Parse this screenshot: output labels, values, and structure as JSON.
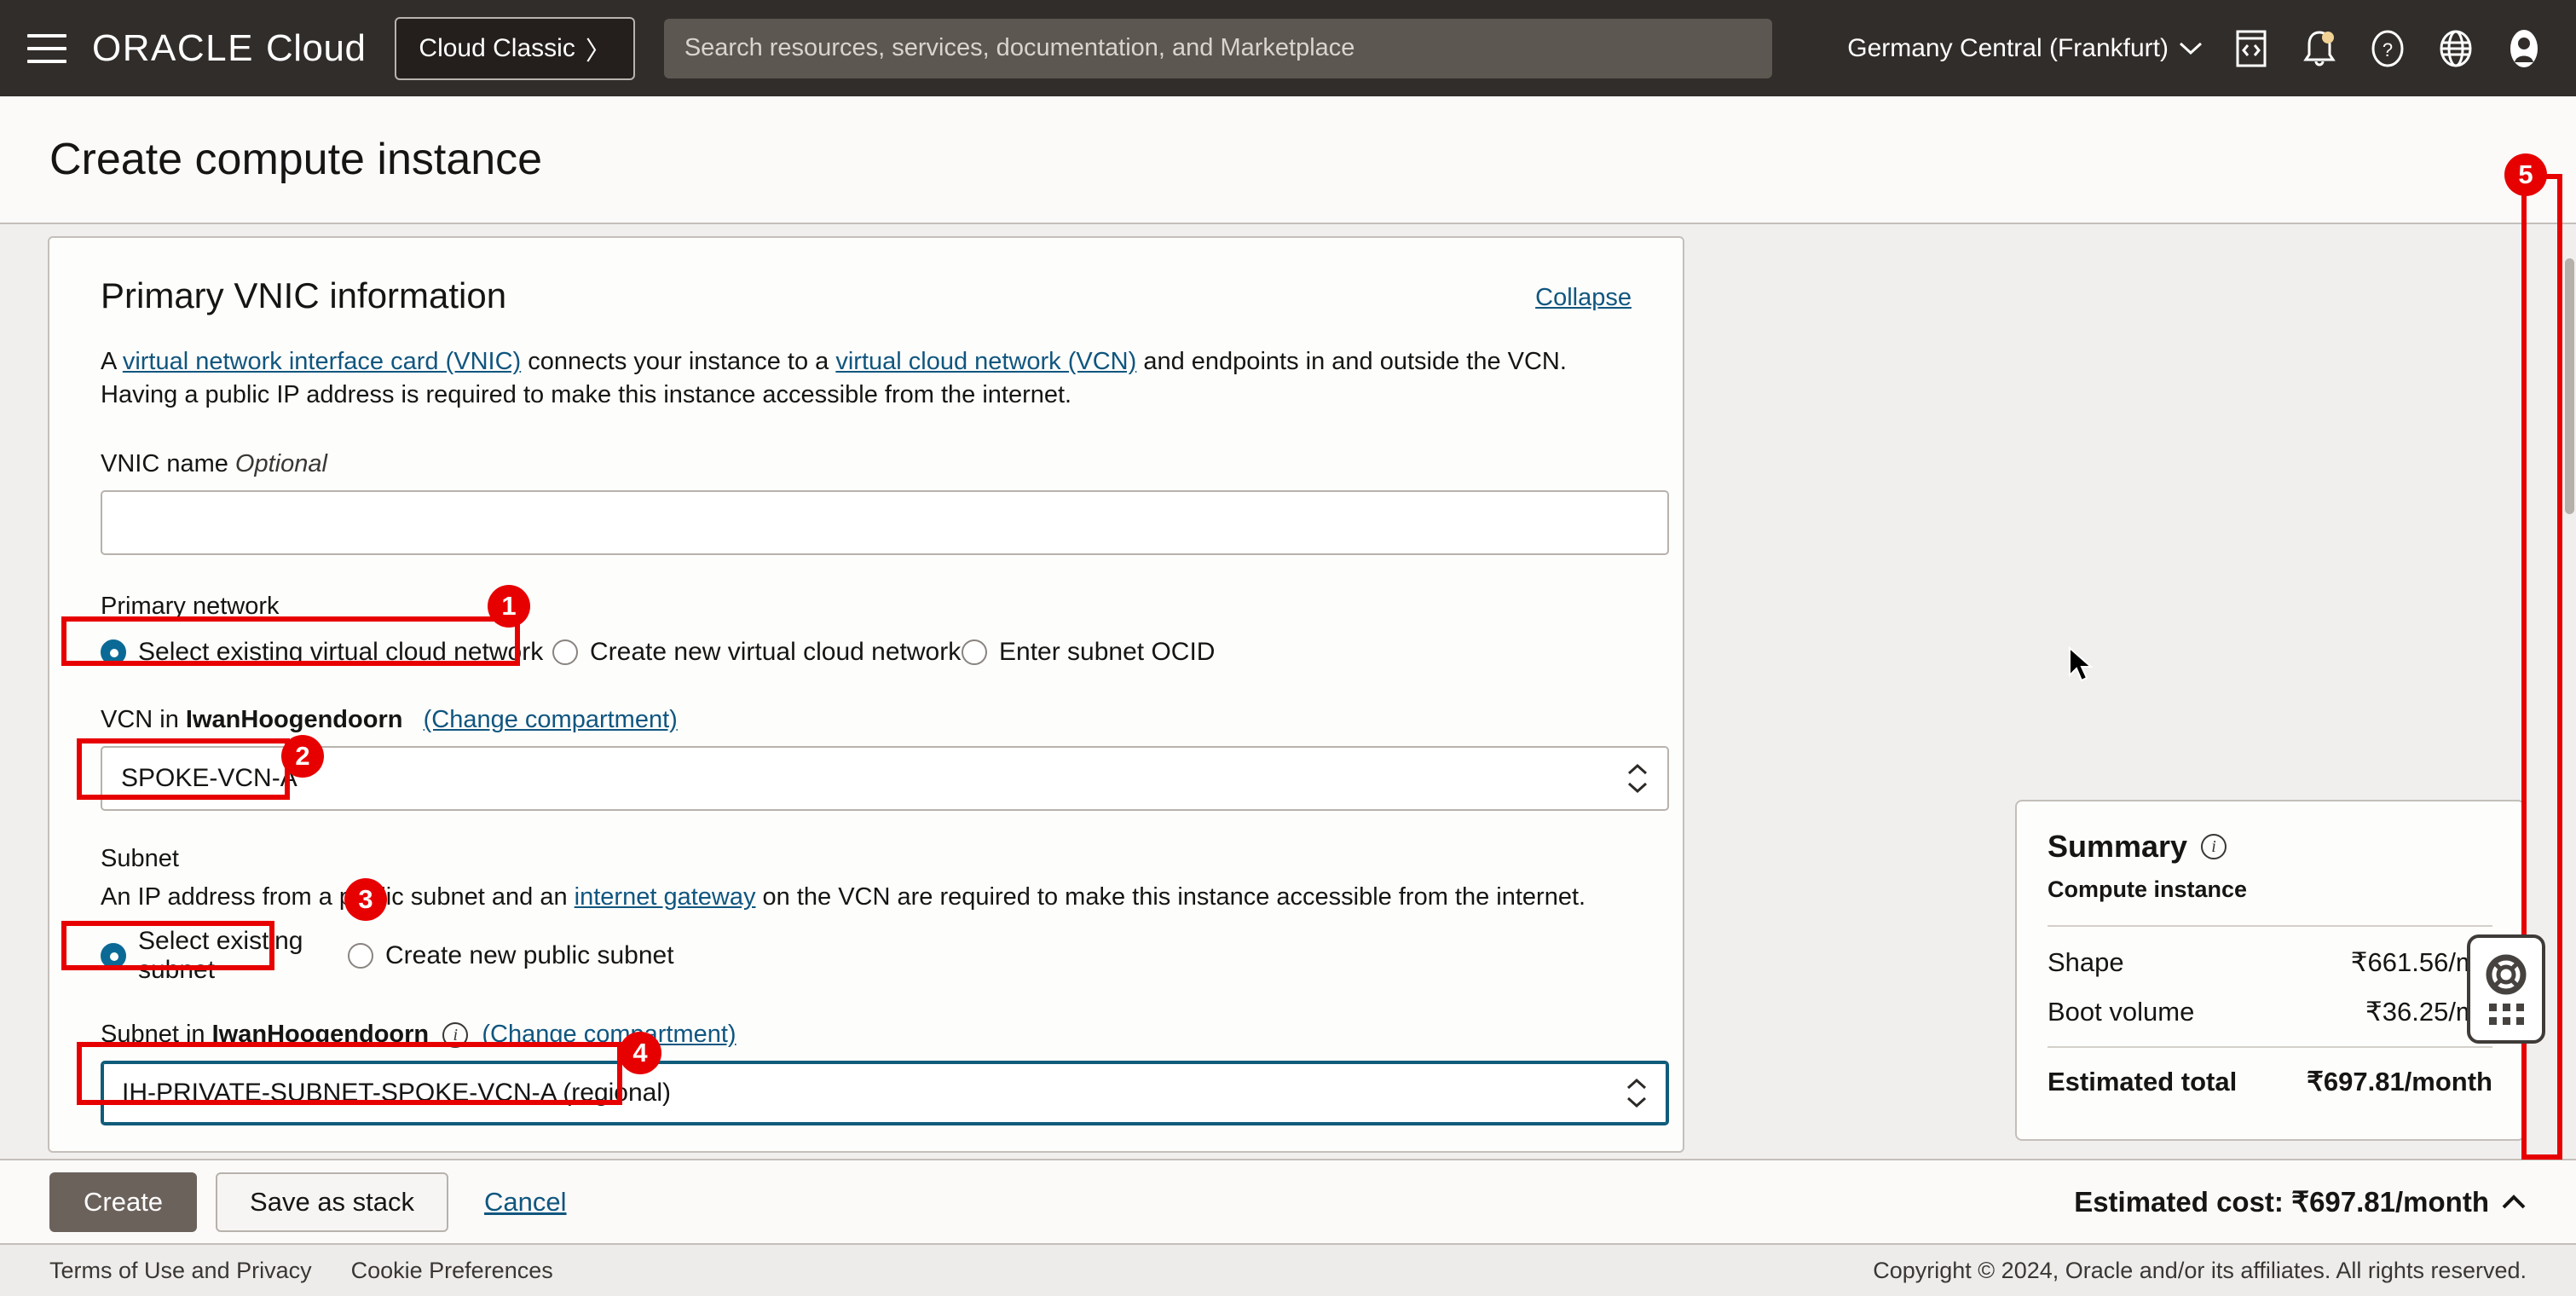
{
  "topnav": {
    "menu_icon": "hamburger-icon",
    "brand_oracle": "ORACLE",
    "brand_cloud": "Cloud",
    "cloud_classic_label": "Cloud Classic",
    "cloud_classic_chevron": "〉",
    "search_placeholder": "Search resources, services, documentation, and Marketplace",
    "region": "Germany Central (Frankfurt)",
    "region_chevron": "∨",
    "icons": [
      "cloud-shell-icon",
      "notifications-bell-icon",
      "help-question-icon",
      "globe-language-icon",
      "user-avatar-icon"
    ],
    "bg_color": "#312d2a"
  },
  "page": {
    "title": "Create compute instance"
  },
  "vnic_card": {
    "title": "Primary VNIC information",
    "collapse_label": "Collapse",
    "desc_part1": "A ",
    "desc_link1": "virtual network interface card (VNIC)",
    "desc_part2": " connects your instance to a ",
    "desc_link2": "virtual cloud network (VCN)",
    "desc_part3": " and endpoints in and outside the VCN. Having a public IP address is required to make this instance accessible from the internet.",
    "vnic_name_label": "VNIC name",
    "vnic_name_optional": "Optional",
    "vnic_name_value": "",
    "primary_network_label": "Primary network",
    "primary_network_options": [
      {
        "label": "Select existing virtual cloud network",
        "selected": true
      },
      {
        "label": "Create new virtual cloud network",
        "selected": false
      },
      {
        "label": "Enter subnet OCID",
        "selected": false
      }
    ],
    "vcn_label_prefix": "VCN in ",
    "vcn_compartment": "IwanHoogendoorn",
    "vcn_change_link": "(Change compartment)",
    "vcn_value": "SPOKE-VCN-A",
    "subnet_section_label": "Subnet",
    "subnet_help_part1": "An IP address from a public subnet and an ",
    "subnet_help_link": "internet gateway",
    "subnet_help_part2": " on the VCN are required to make this instance accessible from the internet.",
    "subnet_options": [
      {
        "label": "Select existing subnet",
        "selected": true
      },
      {
        "label": "Create new public subnet",
        "selected": false
      }
    ],
    "subnet_label_prefix": "Subnet in ",
    "subnet_compartment": "IwanHoogendoorn",
    "subnet_change_link": "(Change compartment)",
    "subnet_value": "IH-PRIVATE-SUBNET-SPOKE-VCN-A (regional)"
  },
  "summary": {
    "title": "Summary",
    "subtitle": "Compute instance",
    "rows": [
      {
        "label": "Shape",
        "value": "₹661.56/mo"
      },
      {
        "label": "Boot volume",
        "value": "₹36.25/mo"
      }
    ],
    "total_label": "Estimated total",
    "total_value": "₹697.81/month"
  },
  "help_widget": {
    "icon": "life-ring-icon",
    "grid_icon": "dots-grid-icon"
  },
  "action_bar": {
    "create_label": "Create",
    "save_stack_label": "Save as stack",
    "cancel_label": "Cancel",
    "estimated_cost": "Estimated cost: ₹697.81/month",
    "estimated_chevron": "∧"
  },
  "footer": {
    "terms": "Terms of Use and Privacy",
    "cookies": "Cookie Preferences",
    "copyright": "Copyright © 2024, Oracle and/or its affiliates. All rights reserved."
  },
  "annotations": [
    {
      "number": "1"
    },
    {
      "number": "2"
    },
    {
      "number": "3"
    },
    {
      "number": "4"
    },
    {
      "number": "5"
    }
  ],
  "colors": {
    "annotation_red": "#e70000",
    "link_blue": "#10567f",
    "radio_selected": "#0b6a95",
    "nav_bg": "#312d2a",
    "create_button": "#6c625c"
  }
}
